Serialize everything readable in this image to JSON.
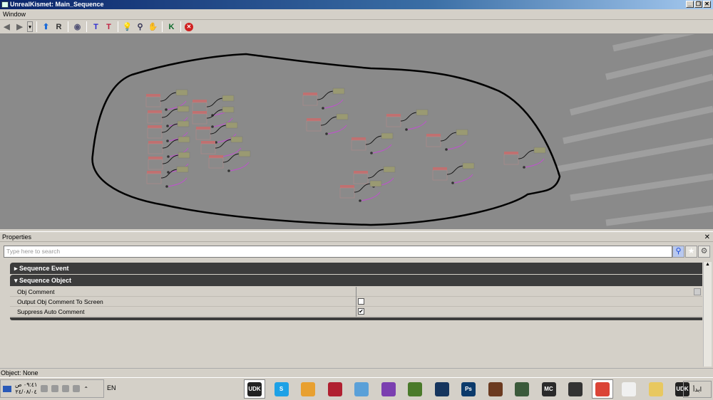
{
  "window": {
    "title": "UnrealKismet: Main_Sequence",
    "controls": [
      "minimize",
      "restore",
      "close"
    ]
  },
  "menu": {
    "items": [
      "Window"
    ]
  },
  "toolbar": {
    "buttons": [
      {
        "icon": "back-arrow-icon"
      },
      {
        "icon": "forward-arrow-icon"
      },
      {
        "icon": "dropdown-icon"
      },
      {
        "icon": "parent-sequence-icon"
      },
      {
        "icon": "rename-icon"
      },
      {
        "icon": "hide-connectors-icon"
      },
      {
        "icon": "move-blue-icon"
      },
      {
        "icon": "move-red-icon"
      },
      {
        "icon": "lightbulb-icon"
      },
      {
        "icon": "search-icon"
      },
      {
        "icon": "zoom-to-fit-icon"
      },
      {
        "icon": "kismet-k-icon"
      },
      {
        "icon": "close-red-icon"
      }
    ]
  },
  "properties": {
    "title": "Properties",
    "search_placeholder": "Type here to search",
    "categories": [
      {
        "label": "Sequence Event",
        "expanded": false
      },
      {
        "label": "Sequence Object",
        "expanded": true,
        "rows": [
          {
            "label": "Obj Comment",
            "type": "text",
            "value": ""
          },
          {
            "label": "Output Obj Comment To Screen",
            "type": "checkbox",
            "checked": false
          },
          {
            "label": "Suppress Auto Comment",
            "type": "checkbox",
            "checked": true
          }
        ]
      }
    ]
  },
  "status": {
    "text": "Object: None"
  },
  "taskbar": {
    "clock_time": "٠٩:٤١ ص",
    "clock_date": "٢٤/٠٨/٠٤",
    "language": "EN",
    "apps": [
      {
        "name": "udk",
        "label": "UDK",
        "color": "#222222",
        "active": true
      },
      {
        "name": "skype",
        "label": "S",
        "color": "#1da1e6"
      },
      {
        "name": "thumbs-app",
        "label": "",
        "color": "#e8a030"
      },
      {
        "name": "winrar",
        "label": "",
        "color": "#b02030"
      },
      {
        "name": "cloud-app",
        "label": "",
        "color": "#5aa0d8"
      },
      {
        "name": "bittorrent",
        "label": "",
        "color": "#7b3fb0"
      },
      {
        "name": "minecraft",
        "label": "",
        "color": "#4a7a2a"
      },
      {
        "name": "monitor-app",
        "label": "",
        "color": "#16355e"
      },
      {
        "name": "photoshop",
        "label": "Ps",
        "color": "#0b3a6b"
      },
      {
        "name": "game-character",
        "label": "",
        "color": "#6b3a20"
      },
      {
        "name": "tool-app",
        "label": "",
        "color": "#3b5a3b"
      },
      {
        "name": "mc-app",
        "label": "MC",
        "color": "#2a2a2a"
      },
      {
        "name": "pen-app",
        "label": "",
        "color": "#333333"
      },
      {
        "name": "chrome",
        "label": "",
        "color": "#db4437",
        "active": true
      },
      {
        "name": "zbrush",
        "label": "",
        "color": "#f0f0f0"
      },
      {
        "name": "file-explorer",
        "label": "",
        "color": "#e8c860"
      },
      {
        "name": "udk-2",
        "label": "UDK",
        "color": "#222222"
      }
    ],
    "start_label": "ابدأ"
  }
}
